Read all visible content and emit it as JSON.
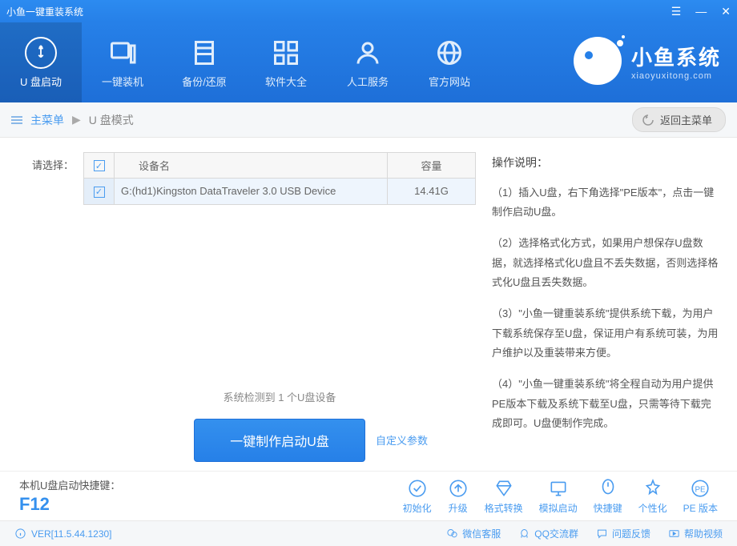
{
  "titlebar": {
    "title": "小鱼一键重装系统"
  },
  "nav": {
    "items": [
      {
        "label": "U 盘启动"
      },
      {
        "label": "一键装机"
      },
      {
        "label": "备份/还原"
      },
      {
        "label": "软件大全"
      },
      {
        "label": "人工服务"
      },
      {
        "label": "官方网站"
      }
    ]
  },
  "brand": {
    "title": "小鱼系统",
    "sub": "xiaoyuxitong.com"
  },
  "breadcrumb": {
    "main": "主菜单",
    "current": "U 盘模式",
    "back": "返回主菜单"
  },
  "select_label": "请选择：",
  "table": {
    "headers": {
      "name": "设备名",
      "capacity": "容量"
    },
    "rows": [
      {
        "name": "G:(hd1)Kingston DataTraveler 3.0 USB Device",
        "capacity": "14.41G",
        "checked": true
      }
    ]
  },
  "status": "系统检测到 1 个U盘设备",
  "make_button": "一键制作启动U盘",
  "custom_link": "自定义参数",
  "instructions": {
    "title": "操作说明：",
    "p1": "（1）插入U盘，右下角选择\"PE版本\"，点击一键制作启动U盘。",
    "p2": "（2）选择格式化方式，如果用户想保存U盘数据，就选择格式化U盘且不丢失数据，否则选择格式化U盘且丢失数据。",
    "p3": "（3）\"小鱼一键重装系统\"提供系统下载，为用户下载系统保存至U盘，保证用户有系统可装，为用户维护以及重装带来方便。",
    "p4": "（4）\"小鱼一键重装系统\"将全程自动为用户提供PE版本下载及系统下载至U盘，只需等待下载完成即可。U盘便制作完成。"
  },
  "hotkey": {
    "label": "本机U盘启动快捷键：",
    "key": "F12"
  },
  "tools": [
    {
      "label": "初始化"
    },
    {
      "label": "升级"
    },
    {
      "label": "格式转换"
    },
    {
      "label": "模拟启动"
    },
    {
      "label": "快捷键"
    },
    {
      "label": "个性化"
    },
    {
      "label": "PE 版本"
    }
  ],
  "footer": {
    "version": "VER[11.5.44.1230]",
    "links": [
      {
        "label": "微信客服"
      },
      {
        "label": "QQ交流群"
      },
      {
        "label": "问题反馈"
      },
      {
        "label": "帮助视频"
      }
    ]
  }
}
